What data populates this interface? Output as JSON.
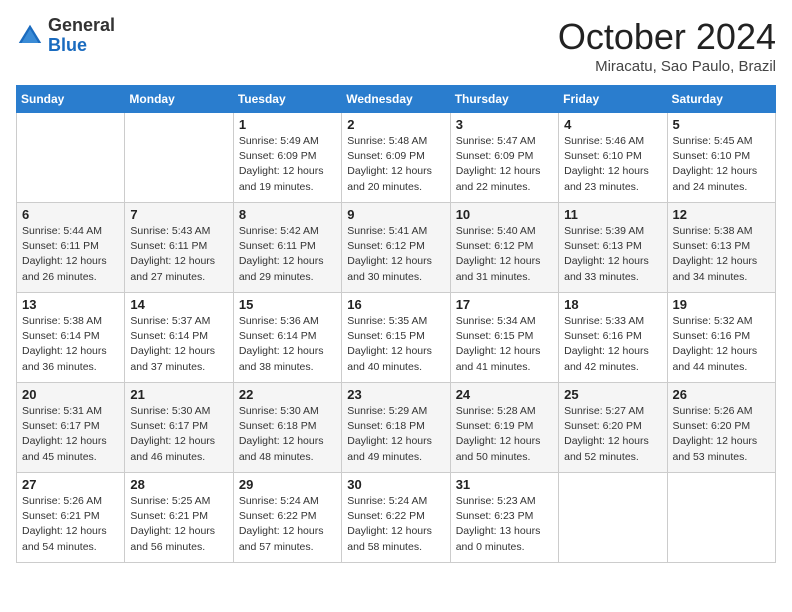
{
  "logo": {
    "general": "General",
    "blue": "Blue"
  },
  "header": {
    "month": "October 2024",
    "location": "Miracatu, Sao Paulo, Brazil"
  },
  "weekdays": [
    "Sunday",
    "Monday",
    "Tuesday",
    "Wednesday",
    "Thursday",
    "Friday",
    "Saturday"
  ],
  "weeks": [
    [
      {
        "day": "",
        "sunrise": "",
        "sunset": "",
        "daylight": ""
      },
      {
        "day": "",
        "sunrise": "",
        "sunset": "",
        "daylight": ""
      },
      {
        "day": "1",
        "sunrise": "Sunrise: 5:49 AM",
        "sunset": "Sunset: 6:09 PM",
        "daylight": "Daylight: 12 hours and 19 minutes."
      },
      {
        "day": "2",
        "sunrise": "Sunrise: 5:48 AM",
        "sunset": "Sunset: 6:09 PM",
        "daylight": "Daylight: 12 hours and 20 minutes."
      },
      {
        "day": "3",
        "sunrise": "Sunrise: 5:47 AM",
        "sunset": "Sunset: 6:09 PM",
        "daylight": "Daylight: 12 hours and 22 minutes."
      },
      {
        "day": "4",
        "sunrise": "Sunrise: 5:46 AM",
        "sunset": "Sunset: 6:10 PM",
        "daylight": "Daylight: 12 hours and 23 minutes."
      },
      {
        "day": "5",
        "sunrise": "Sunrise: 5:45 AM",
        "sunset": "Sunset: 6:10 PM",
        "daylight": "Daylight: 12 hours and 24 minutes."
      }
    ],
    [
      {
        "day": "6",
        "sunrise": "Sunrise: 5:44 AM",
        "sunset": "Sunset: 6:11 PM",
        "daylight": "Daylight: 12 hours and 26 minutes."
      },
      {
        "day": "7",
        "sunrise": "Sunrise: 5:43 AM",
        "sunset": "Sunset: 6:11 PM",
        "daylight": "Daylight: 12 hours and 27 minutes."
      },
      {
        "day": "8",
        "sunrise": "Sunrise: 5:42 AM",
        "sunset": "Sunset: 6:11 PM",
        "daylight": "Daylight: 12 hours and 29 minutes."
      },
      {
        "day": "9",
        "sunrise": "Sunrise: 5:41 AM",
        "sunset": "Sunset: 6:12 PM",
        "daylight": "Daylight: 12 hours and 30 minutes."
      },
      {
        "day": "10",
        "sunrise": "Sunrise: 5:40 AM",
        "sunset": "Sunset: 6:12 PM",
        "daylight": "Daylight: 12 hours and 31 minutes."
      },
      {
        "day": "11",
        "sunrise": "Sunrise: 5:39 AM",
        "sunset": "Sunset: 6:13 PM",
        "daylight": "Daylight: 12 hours and 33 minutes."
      },
      {
        "day": "12",
        "sunrise": "Sunrise: 5:38 AM",
        "sunset": "Sunset: 6:13 PM",
        "daylight": "Daylight: 12 hours and 34 minutes."
      }
    ],
    [
      {
        "day": "13",
        "sunrise": "Sunrise: 5:38 AM",
        "sunset": "Sunset: 6:14 PM",
        "daylight": "Daylight: 12 hours and 36 minutes."
      },
      {
        "day": "14",
        "sunrise": "Sunrise: 5:37 AM",
        "sunset": "Sunset: 6:14 PM",
        "daylight": "Daylight: 12 hours and 37 minutes."
      },
      {
        "day": "15",
        "sunrise": "Sunrise: 5:36 AM",
        "sunset": "Sunset: 6:14 PM",
        "daylight": "Daylight: 12 hours and 38 minutes."
      },
      {
        "day": "16",
        "sunrise": "Sunrise: 5:35 AM",
        "sunset": "Sunset: 6:15 PM",
        "daylight": "Daylight: 12 hours and 40 minutes."
      },
      {
        "day": "17",
        "sunrise": "Sunrise: 5:34 AM",
        "sunset": "Sunset: 6:15 PM",
        "daylight": "Daylight: 12 hours and 41 minutes."
      },
      {
        "day": "18",
        "sunrise": "Sunrise: 5:33 AM",
        "sunset": "Sunset: 6:16 PM",
        "daylight": "Daylight: 12 hours and 42 minutes."
      },
      {
        "day": "19",
        "sunrise": "Sunrise: 5:32 AM",
        "sunset": "Sunset: 6:16 PM",
        "daylight": "Daylight: 12 hours and 44 minutes."
      }
    ],
    [
      {
        "day": "20",
        "sunrise": "Sunrise: 5:31 AM",
        "sunset": "Sunset: 6:17 PM",
        "daylight": "Daylight: 12 hours and 45 minutes."
      },
      {
        "day": "21",
        "sunrise": "Sunrise: 5:30 AM",
        "sunset": "Sunset: 6:17 PM",
        "daylight": "Daylight: 12 hours and 46 minutes."
      },
      {
        "day": "22",
        "sunrise": "Sunrise: 5:30 AM",
        "sunset": "Sunset: 6:18 PM",
        "daylight": "Daylight: 12 hours and 48 minutes."
      },
      {
        "day": "23",
        "sunrise": "Sunrise: 5:29 AM",
        "sunset": "Sunset: 6:18 PM",
        "daylight": "Daylight: 12 hours and 49 minutes."
      },
      {
        "day": "24",
        "sunrise": "Sunrise: 5:28 AM",
        "sunset": "Sunset: 6:19 PM",
        "daylight": "Daylight: 12 hours and 50 minutes."
      },
      {
        "day": "25",
        "sunrise": "Sunrise: 5:27 AM",
        "sunset": "Sunset: 6:20 PM",
        "daylight": "Daylight: 12 hours and 52 minutes."
      },
      {
        "day": "26",
        "sunrise": "Sunrise: 5:26 AM",
        "sunset": "Sunset: 6:20 PM",
        "daylight": "Daylight: 12 hours and 53 minutes."
      }
    ],
    [
      {
        "day": "27",
        "sunrise": "Sunrise: 5:26 AM",
        "sunset": "Sunset: 6:21 PM",
        "daylight": "Daylight: 12 hours and 54 minutes."
      },
      {
        "day": "28",
        "sunrise": "Sunrise: 5:25 AM",
        "sunset": "Sunset: 6:21 PM",
        "daylight": "Daylight: 12 hours and 56 minutes."
      },
      {
        "day": "29",
        "sunrise": "Sunrise: 5:24 AM",
        "sunset": "Sunset: 6:22 PM",
        "daylight": "Daylight: 12 hours and 57 minutes."
      },
      {
        "day": "30",
        "sunrise": "Sunrise: 5:24 AM",
        "sunset": "Sunset: 6:22 PM",
        "daylight": "Daylight: 12 hours and 58 minutes."
      },
      {
        "day": "31",
        "sunrise": "Sunrise: 5:23 AM",
        "sunset": "Sunset: 6:23 PM",
        "daylight": "Daylight: 13 hours and 0 minutes."
      },
      {
        "day": "",
        "sunrise": "",
        "sunset": "",
        "daylight": ""
      },
      {
        "day": "",
        "sunrise": "",
        "sunset": "",
        "daylight": ""
      }
    ]
  ]
}
